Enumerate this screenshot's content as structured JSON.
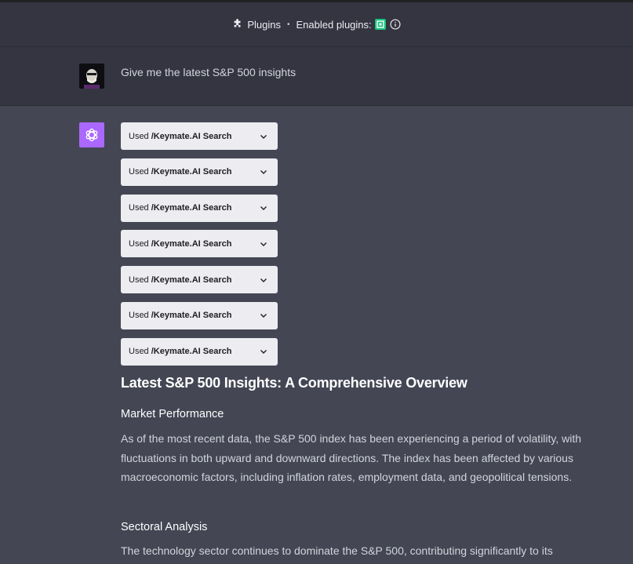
{
  "header": {
    "plugins_label": "Plugins",
    "separator": "•",
    "enabled_label": "Enabled plugins:",
    "plugin_icon": "keymate-logo",
    "info_icon": "info-icon"
  },
  "user_message": {
    "avatar": "user-avatar",
    "text": "Give me the latest S&P 500 insights"
  },
  "assistant": {
    "avatar": "openai-logo",
    "tool_calls": [
      {
        "prefix": "Used",
        "name": "/Keymate.AI Search"
      },
      {
        "prefix": "Used",
        "name": "/Keymate.AI Search"
      },
      {
        "prefix": "Used",
        "name": "/Keymate.AI Search"
      },
      {
        "prefix": "Used",
        "name": "/Keymate.AI Search"
      },
      {
        "prefix": "Used",
        "name": "/Keymate.AI Search"
      },
      {
        "prefix": "Used",
        "name": "/Keymate.AI Search"
      },
      {
        "prefix": "Used",
        "name": "/Keymate.AI Search"
      }
    ],
    "title": "Latest S&P 500 Insights: A Comprehensive Overview",
    "sections": [
      {
        "heading": "Market Performance",
        "body": "As of the most recent data, the S&P 500 index has been experiencing a period of volatility, with fluctuations in both upward and downward directions. The index has been affected by various macroeconomic factors, including inflation rates, employment data, and geopolitical tensions."
      },
      {
        "heading": "Sectoral Analysis",
        "body": "The technology sector continues to dominate the S&P 500, contributing significantly to its"
      }
    ]
  },
  "colors": {
    "page_bg": "#444654",
    "header_bg": "#343541",
    "tool_bg": "#ececf1",
    "assistant_avatar_bg": "#ab68ff",
    "plugin_logo": "#19c37d"
  }
}
